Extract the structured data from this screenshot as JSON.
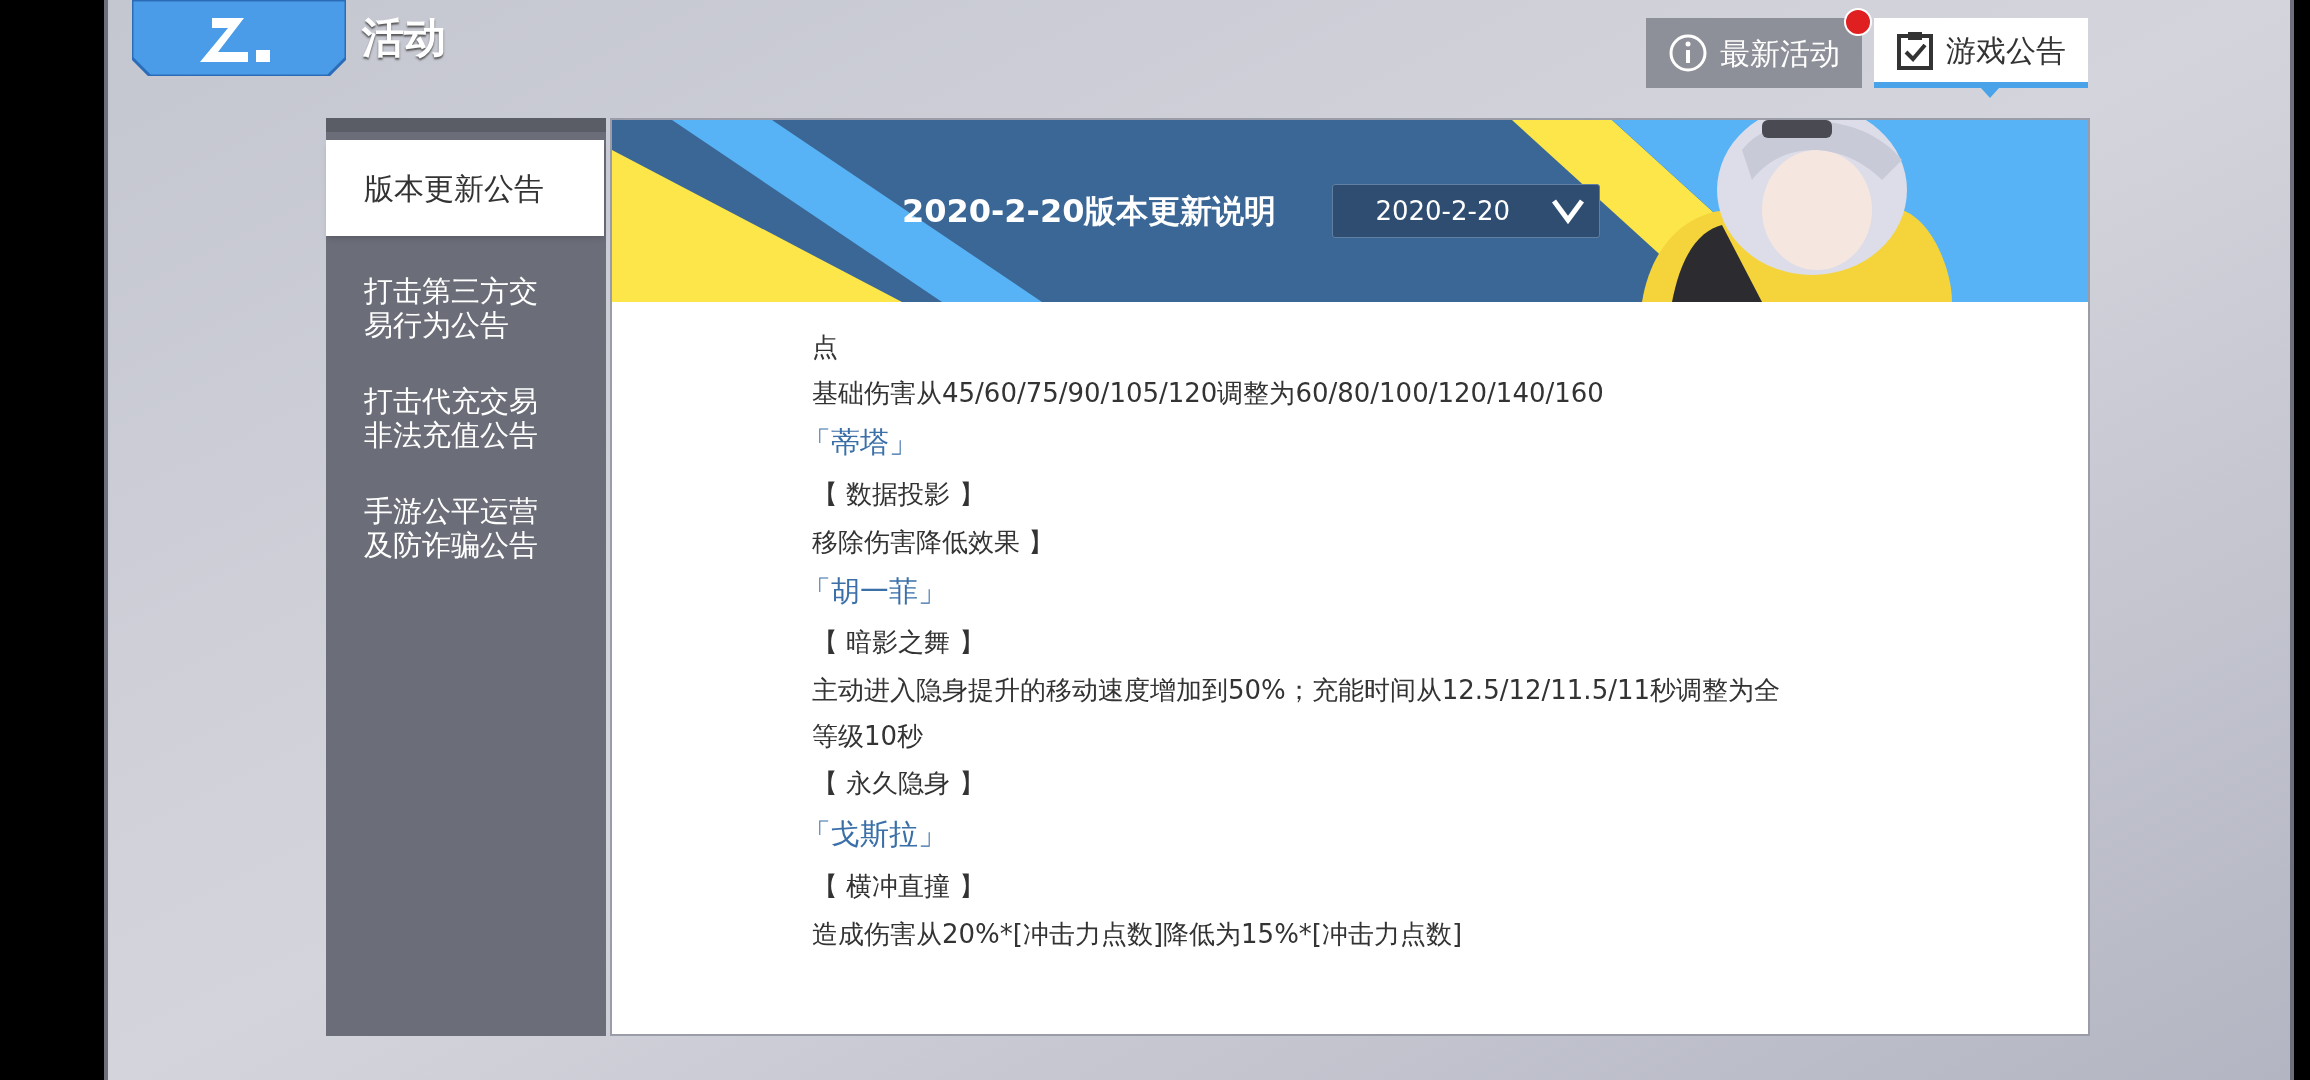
{
  "header": {
    "title": "活动"
  },
  "top_buttons": [
    {
      "label": "最新活动",
      "alert": true,
      "selected": false
    },
    {
      "label": "游戏公告",
      "alert": false,
      "selected": true
    }
  ],
  "sidebar": {
    "items": [
      {
        "label": "版本更新公告",
        "selected": true
      },
      {
        "label": "打击第三方交易行为公告",
        "selected": false
      },
      {
        "label": "打击代充交易非法充值公告",
        "selected": false
      },
      {
        "label": "手游公平运营及防诈骗公告",
        "selected": false
      }
    ]
  },
  "banner": {
    "title": "2020-2-20版本更新说明",
    "dropdown": {
      "value": "2020-2-20"
    }
  },
  "content": [
    {
      "kind": "text",
      "text": "点"
    },
    {
      "kind": "text",
      "text": "基础伤害从45/60/75/90/105/120调整为60/80/100/120/140/160"
    },
    {
      "kind": "hero",
      "text": "「蒂塔」"
    },
    {
      "kind": "skill",
      "text": "【 数据投影 】"
    },
    {
      "kind": "text",
      "text": "移除伤害降低效果 】"
    },
    {
      "kind": "hero",
      "text": "「胡一菲」"
    },
    {
      "kind": "skill",
      "text": "【 暗影之舞 】"
    },
    {
      "kind": "text",
      "text": "主动进入隐身提升的移动速度增加到50%；充能时间从12.5/12/11.5/11秒调整为全等级10秒"
    },
    {
      "kind": "skill",
      "text": "【 永久隐身 】"
    },
    {
      "kind": "hero",
      "text": "「戈斯拉」"
    },
    {
      "kind": "skill",
      "text": "【 横冲直撞 】"
    },
    {
      "kind": "text",
      "text": "造成伤害从20%*[冲击力点数]降低为15%*[冲击力点数]"
    }
  ]
}
